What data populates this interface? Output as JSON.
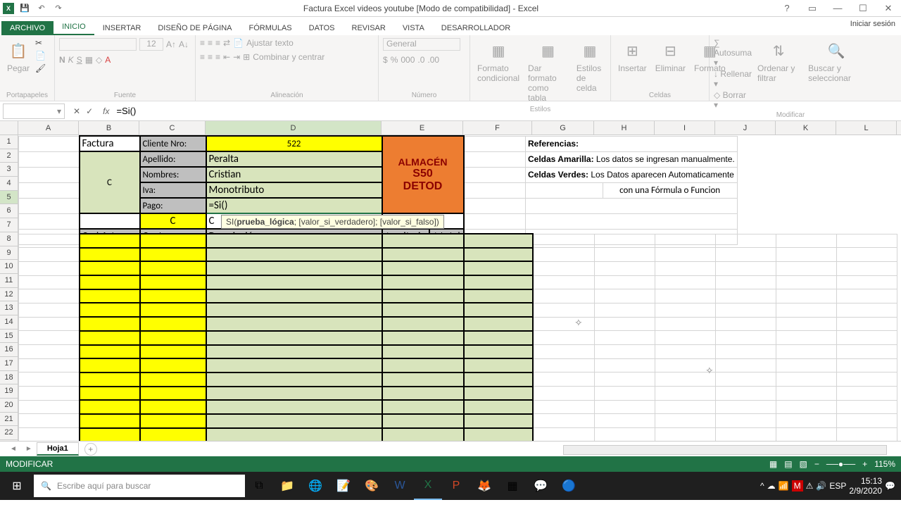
{
  "title": "Factura Excel videos youtube  [Modo de compatibilidad] - Excel",
  "signin": "Iniciar sesión",
  "tabs": {
    "file": "ARCHIVO",
    "inicio": "INICIO",
    "insertar": "INSERTAR",
    "diseno": "DISEÑO DE PÁGINA",
    "formulas": "FÓRMULAS",
    "datos": "DATOS",
    "revisar": "REVISAR",
    "vista": "VISTA",
    "desarrollador": "DESARROLLADOR"
  },
  "ribbon": {
    "portapapeles": {
      "label": "Portapapeles",
      "pegar": "Pegar"
    },
    "fuente": {
      "label": "Fuente",
      "size": "12",
      "bold": "N",
      "italic": "K",
      "underline": "S"
    },
    "alineacion": {
      "label": "Alineación",
      "ajustar": "Ajustar texto",
      "combinar": "Combinar y centrar"
    },
    "numero": {
      "label": "Número",
      "general": "General"
    },
    "estilos": {
      "label": "Estilos",
      "cond": "Formato condicional",
      "tabla": "Dar formato como tabla",
      "celda": "Estilos de celda"
    },
    "celdas": {
      "label": "Celdas",
      "insertar": "Insertar",
      "eliminar": "Eliminar",
      "formato": "Formato"
    },
    "modificar": {
      "label": "Modificar",
      "autosuma": "Autosuma",
      "rellenar": "Rellenar",
      "borrar": "Borrar",
      "ordenar": "Ordenar y filtrar",
      "buscar": "Buscar y seleccionar"
    }
  },
  "namebox": "",
  "formula": "=Si()",
  "colheads": [
    "A",
    "B",
    "C",
    "D",
    "E",
    "F",
    "G",
    "H",
    "I",
    "J",
    "K",
    "L"
  ],
  "rownums": [
    "1",
    "2",
    "3",
    "4",
    "5",
    "6",
    "7",
    "8",
    "9",
    "10",
    "11",
    "12",
    "13",
    "14",
    "15",
    "16",
    "17",
    "18",
    "19",
    "20",
    "21",
    "22"
  ],
  "cells": {
    "factura": "Factura",
    "cliente_label": "Cliente Nro:",
    "cliente_val": "522",
    "apellido_label": "Apellido:",
    "apellido_val": "Peralta",
    "nombres_label": "Nombres:",
    "nombres_val": "Cristian",
    "iva_label": "Iva:",
    "iva_val": "Monotributo",
    "pago_label": "Pago:",
    "pago_val": "=Si()",
    "c_big": "C",
    "c_small": "C",
    "c_hint": "C",
    "almacen": "ALMACÉN",
    "s50": "S50",
    "detod": "DETOD",
    "cod": "Cod.Art.",
    "cant": "Cant.",
    "desc": "Descripción",
    "unit": "$ unitario",
    "total": "$ total",
    "ref": "Referencias:",
    "amarilla_l": "Celdas Amarilla:",
    "amarilla_t": " Los datos se ingresan manualmente.",
    "verdes_l": "Celdas Verdes:",
    "verdes_t": " Los Datos aparecen Automaticamente",
    "verdes_t2": "con una Fórmula o Funcion"
  },
  "tooltip": {
    "fn": "SI(",
    "arg1": "prueba_lógica",
    "rest": "; [valor_si_verdadero]; [valor_si_falso])"
  },
  "sheet": "Hoja1",
  "status": {
    "mode": "MODIFICAR",
    "zoom": "115%"
  },
  "taskbar": {
    "search": "Escribe aquí para buscar",
    "time": "15:13",
    "date": "2/9/2020",
    "lang": "ESP"
  }
}
